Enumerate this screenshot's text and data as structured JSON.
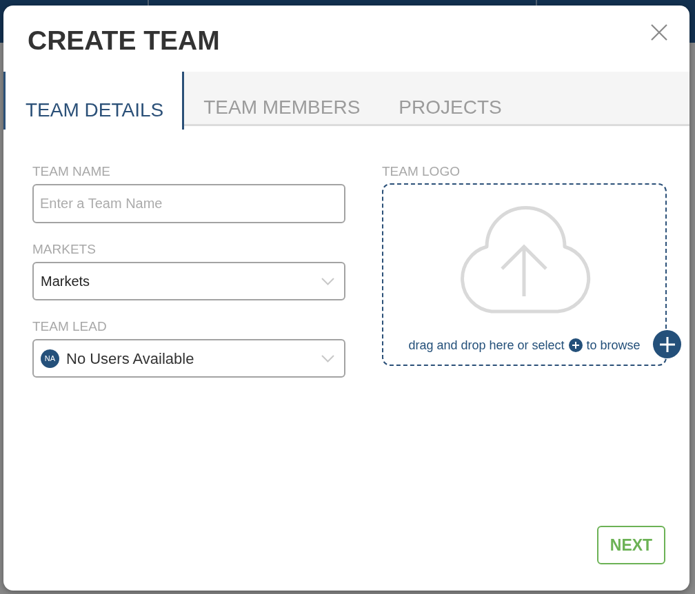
{
  "dialog": {
    "title": "CREATE TEAM"
  },
  "tabs": [
    {
      "label": "TEAM DETAILS",
      "selected": true
    },
    {
      "label": "TEAM MEMBERS",
      "selected": false
    },
    {
      "label": "PROJECTS",
      "selected": false
    }
  ],
  "fields": [
    {
      "kind": "text",
      "label": "TEAM NAME",
      "placeholder": "Enter a Team Name"
    },
    {
      "kind": "select",
      "label": "MARKETS",
      "value": "Markets"
    },
    {
      "kind": "select",
      "label": "TEAM LEAD",
      "value": "No Users Available",
      "avatar": "NA"
    }
  ],
  "logo_upload": {
    "label": "TEAM LOGO",
    "hint_before": "drag and drop here or select",
    "hint_after": "to browse"
  },
  "buttons": [
    {
      "label": "NEXT"
    }
  ]
}
